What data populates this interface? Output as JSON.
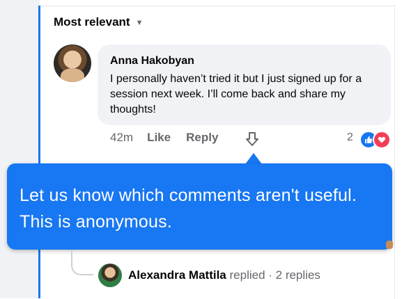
{
  "sort": {
    "label": "Most relevant",
    "chevron_icon": "chevron-down-icon"
  },
  "comment": {
    "author": "Anna Hakobyan",
    "text": "I personally haven’t tried it but I just signed up for a session next week. I’ll come back and share my thoughts!",
    "time": "42m",
    "like_label": "Like",
    "reply_label": "Reply",
    "downvote_icon": "thumb-down-arrow-icon",
    "reaction_count": "2",
    "reactions": [
      "like",
      "love"
    ]
  },
  "tooltip": {
    "text": "Let us know which comments aren't useful. This is anonymous."
  },
  "replies": {
    "name": "Alexandra Mattila",
    "suffix": "replied · 2 replies"
  },
  "colors": {
    "accent": "#1877f2",
    "love": "#f33e58",
    "bubble": "#f0f2f5",
    "secondary_text": "#65676b"
  }
}
